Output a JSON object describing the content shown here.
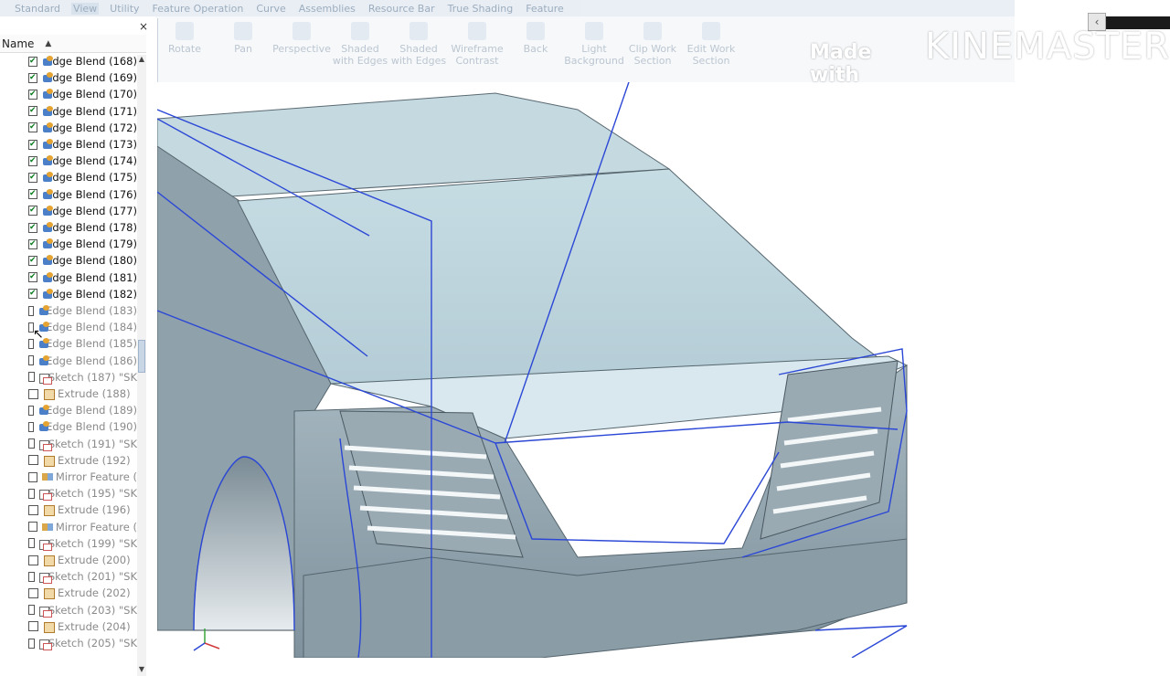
{
  "menubar": {
    "tabs": [
      "Standard",
      "View",
      "Utility",
      "Feature Operation",
      "Curve",
      "Assemblies",
      "Resource Bar",
      "True Shading",
      "Feature"
    ],
    "active": "View"
  },
  "toolbar": {
    "buttons": [
      {
        "label": "Rotate",
        "icon": "rotate-icon"
      },
      {
        "label": "Pan",
        "icon": "pan-icon"
      },
      {
        "label": "Perspective",
        "icon": "perspective-icon"
      },
      {
        "label": "Shaded with Edges",
        "icon": "shaded-edges-icon"
      },
      {
        "label": "Shaded with Edges",
        "icon": "shaded-edges-icon"
      },
      {
        "label": "Wireframe Contrast",
        "icon": "wireframe-icon"
      },
      {
        "label": "Back",
        "icon": "back-icon"
      },
      {
        "label": "Light Background",
        "icon": "background-icon"
      },
      {
        "label": "Clip Work Section",
        "icon": "clip-icon"
      },
      {
        "label": "Edit Work Section",
        "icon": "edit-section-icon"
      }
    ]
  },
  "watermark": {
    "prefix": "Made with",
    "brand": "KINEMASTER"
  },
  "navigator": {
    "column_header": "Name",
    "close_label": "×",
    "items": [
      {
        "label": "Edge Blend (168)",
        "icon": "blend",
        "checked": true
      },
      {
        "label": "Edge Blend (169)",
        "icon": "blend",
        "checked": true
      },
      {
        "label": "Edge Blend (170)",
        "icon": "blend",
        "checked": true
      },
      {
        "label": "Edge Blend (171)",
        "icon": "blend",
        "checked": true
      },
      {
        "label": "Edge Blend (172)",
        "icon": "blend",
        "checked": true
      },
      {
        "label": "Edge Blend (173)",
        "icon": "blend",
        "checked": true
      },
      {
        "label": "Edge Blend (174)",
        "icon": "blend",
        "checked": true
      },
      {
        "label": "Edge Blend (175)",
        "icon": "blend",
        "checked": true
      },
      {
        "label": "Edge Blend (176)",
        "icon": "blend",
        "checked": true
      },
      {
        "label": "Edge Blend (177)",
        "icon": "blend",
        "checked": true
      },
      {
        "label": "Edge Blend (178)",
        "icon": "blend",
        "checked": true
      },
      {
        "label": "Edge Blend (179)",
        "icon": "blend",
        "checked": true
      },
      {
        "label": "Edge Blend (180)",
        "icon": "blend",
        "checked": true
      },
      {
        "label": "Edge Blend (181)",
        "icon": "blend",
        "checked": true
      },
      {
        "label": "Edge Blend (182)",
        "icon": "blend",
        "checked": true
      },
      {
        "label": "Edge Blend (183)",
        "icon": "blend",
        "checked": false
      },
      {
        "label": "Edge Blend (184)",
        "icon": "blend",
        "checked": false
      },
      {
        "label": "Edge Blend (185)",
        "icon": "blend",
        "checked": false
      },
      {
        "label": "Edge Blend (186)",
        "icon": "blend",
        "checked": false
      },
      {
        "label": "Sketch (187) \"SK",
        "icon": "sketch",
        "checked": false
      },
      {
        "label": "Extrude (188)",
        "icon": "extrude",
        "checked": false
      },
      {
        "label": "Edge Blend (189)",
        "icon": "blend",
        "checked": false
      },
      {
        "label": "Edge Blend (190)",
        "icon": "blend",
        "checked": false
      },
      {
        "label": "Sketch (191) \"SK",
        "icon": "sketch",
        "checked": false
      },
      {
        "label": "Extrude (192)",
        "icon": "extrude",
        "checked": false
      },
      {
        "label": "Mirror Feature (",
        "icon": "mirror",
        "checked": false
      },
      {
        "label": "Sketch (195) \"SK",
        "icon": "sketch",
        "checked": false
      },
      {
        "label": "Extrude (196)",
        "icon": "extrude",
        "checked": false
      },
      {
        "label": "Mirror Feature (",
        "icon": "mirror",
        "checked": false
      },
      {
        "label": "Sketch (199) \"SK",
        "icon": "sketch",
        "checked": false
      },
      {
        "label": "Extrude (200)",
        "icon": "extrude",
        "checked": false
      },
      {
        "label": "Sketch (201) \"SK",
        "icon": "sketch",
        "checked": false
      },
      {
        "label": "Extrude (202)",
        "icon": "extrude",
        "checked": false
      },
      {
        "label": "Sketch (203) \"SK",
        "icon": "sketch",
        "checked": false
      },
      {
        "label": "Extrude (204)",
        "icon": "extrude",
        "checked": false
      },
      {
        "label": "Sketch (205) \"SK",
        "icon": "sketch",
        "checked": false
      }
    ]
  },
  "colors": {
    "body_surface": "#b9cdd6",
    "body_dark": "#8fa2ad",
    "wire": "#2b47d6",
    "check": "#0a7d1e"
  }
}
